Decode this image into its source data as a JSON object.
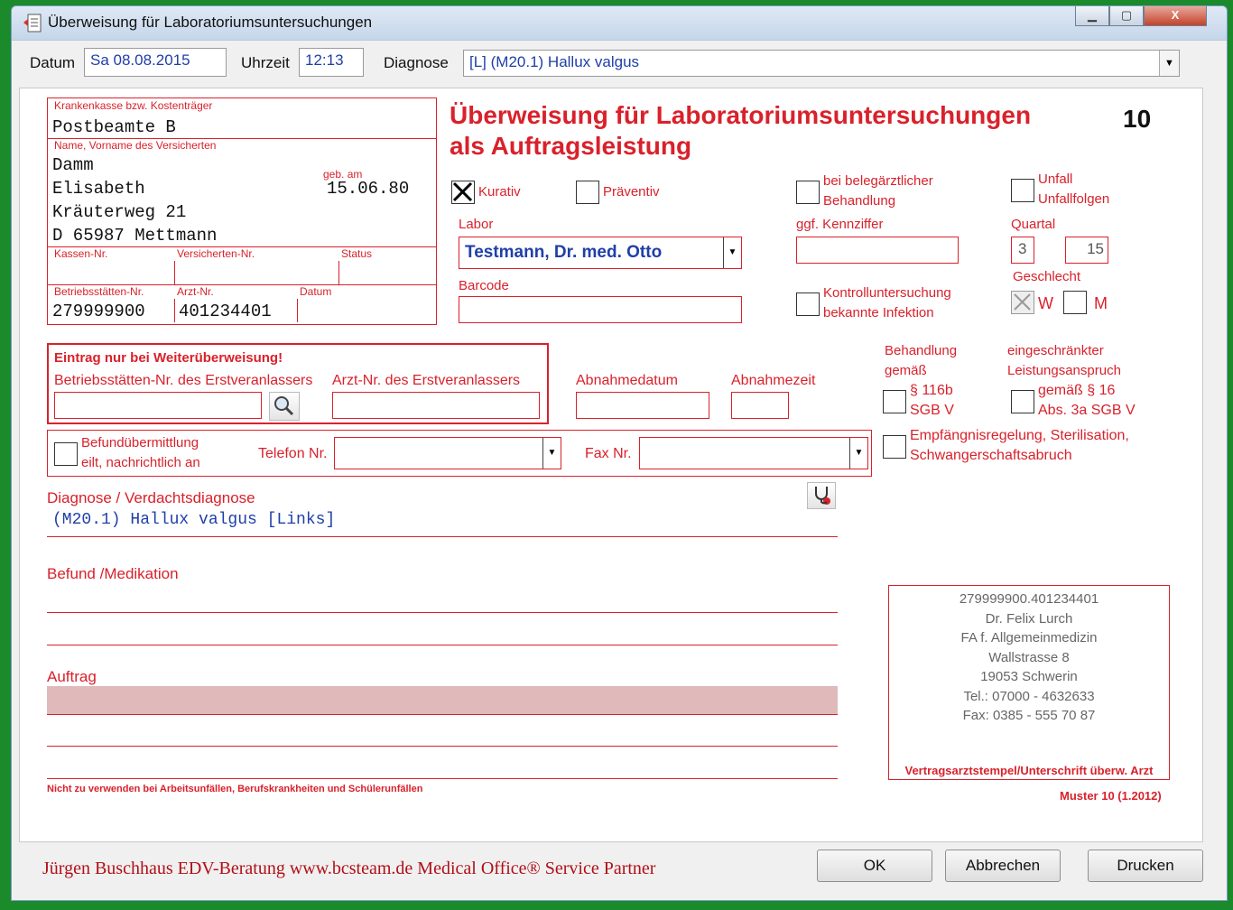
{
  "window": {
    "title": "Überweisung für Laboratoriumsuntersuchungen",
    "minimize": "▁",
    "maximize": "▢",
    "close": "X"
  },
  "header": {
    "datum_label": "Datum",
    "datum_value": "Sa 08.08.2015",
    "uhrzeit_label": "Uhrzeit",
    "uhrzeit_value": "12:13",
    "diagnose_label": "Diagnose",
    "diagnose_value": "[L] (M20.1) Hallux valgus"
  },
  "form": {
    "title_line1": "Überweisung für Laboratoriumsuntersuchungen",
    "title_line2": "als Auftragsleistung",
    "muster_number": "10",
    "patient": {
      "kasse_label": "Krankenkasse bzw. Kostenträger",
      "kasse_value": "Postbeamte B",
      "name_label": "Name, Vorname des Versicherten",
      "lastname": "Damm",
      "firstname": "Elisabeth",
      "street": "Kräuterweg 21",
      "city": "D 65987 Mettmann",
      "geb_label": "geb. am",
      "geb_value": "15.06.80",
      "kassen_nr_label": "Kassen-Nr.",
      "versicherten_nr_label": "Versicherten-Nr.",
      "status_label": "Status",
      "bsnr_label": "Betriebsstätten-Nr.",
      "bsnr_value": "279999900",
      "arzt_nr_label": "Arzt-Nr.",
      "arzt_nr_value": "401234401",
      "datum_label": "Datum"
    },
    "kurativ_label": "Kurativ",
    "kurativ_checked": true,
    "praeventiv_label": "Präventiv",
    "beleg_label_1": "bei belegärztlicher",
    "beleg_label_2": "Behandlung",
    "unfall_label_1": "Unfall",
    "unfall_label_2": "Unfallfolgen",
    "labor_label": "Labor",
    "labor_value": "Testmann, Dr. med. Otto",
    "kennziffer_label": "ggf. Kennziffer",
    "quartal_label": "Quartal",
    "quartal_value": "3",
    "quartal_year": "15",
    "barcode_label": "Barcode",
    "kontroll_label_1": "Kontrolluntersuchung",
    "kontroll_label_2": "bekannte Infektion",
    "geschlecht_label": "Geschlecht",
    "w_label": "W",
    "m_label": "M",
    "w_checked": true,
    "weiter_title": "Eintrag nur bei Weiterüberweisung!",
    "weiter_bsnr_label": "Betriebsstätten-Nr. des Erstveranlassers",
    "weiter_arzt_label": "Arzt-Nr. des Erstveranlassers",
    "abnahmedatum_label": "Abnahmedatum",
    "abnahmezeit_label": "Abnahmezeit",
    "behandlung_label_1": "Behandlung",
    "behandlung_label_2": "gemäß",
    "s116b_label_1": "§ 116b",
    "s116b_label_2": "SGB V",
    "eingeschr_label_1": "eingeschränkter",
    "eingeschr_label_2": "Leistungsanspruch",
    "s16_label_1": "gemäß § 16",
    "s16_label_2": "Abs. 3a SGB V",
    "befund_ueb_label_1": "Befundübermittlung",
    "befund_ueb_label_2": "eilt, nachrichtlich an",
    "telefon_label": "Telefon Nr.",
    "fax_label": "Fax Nr.",
    "empf_label_1": "Empfängnisregelung, Sterilisation,",
    "empf_label_2": "Schwangerschaftsabruch",
    "diagnose_section_label": "Diagnose / Verdachtsdiagnose",
    "diagnose_text": "(M20.1) Hallux valgus [Links]",
    "befund_label": "Befund /Medikation",
    "auftrag_label": "Auftrag",
    "footer_note": "Nicht zu verwenden bei Arbeitsunfällen, Berufskrankheiten und Schülerunfällen",
    "stamp": [
      "279999900.401234401",
      "Dr. Felix Lurch",
      "FA f. Allgemeinmedizin",
      "Wallstrasse 8",
      "19053 Schwerin",
      "Tel.: 07000 - 4632633",
      "Fax: 0385 - 555 70 87"
    ],
    "stamp_caption": "Vertragsarztstempel/Unterschrift überw. Arzt",
    "muster_version": "Muster 10 (1.2012)"
  },
  "footer": {
    "watermark": "Jürgen Buschhaus EDV-Beratung www.bcsteam.de  Medical Office® Service Partner",
    "ok": "OK",
    "abbrechen": "Abbrechen",
    "drucken": "Drucken"
  },
  "colors": {
    "accent_red": "#d9212b",
    "field_blue": "#1f3fa8",
    "window_border": "#1a8a2a"
  }
}
